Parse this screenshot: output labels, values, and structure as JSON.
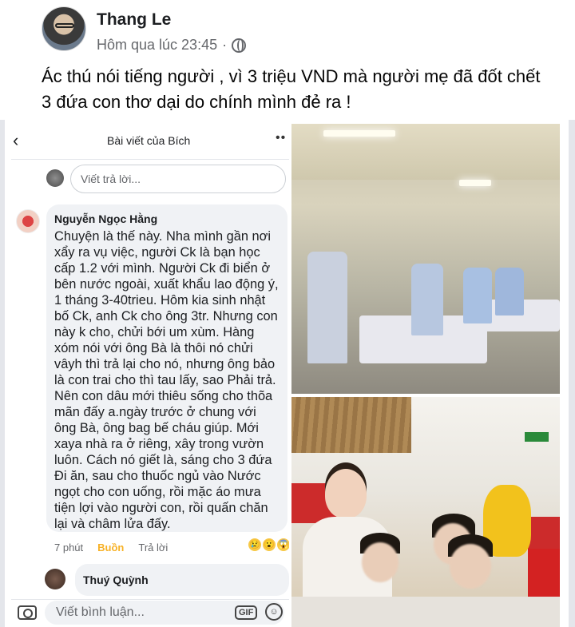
{
  "post": {
    "author": "Thang Le",
    "timestamp": "Hôm qua lúc 23:45",
    "separator": "·",
    "text": "Ác thú nói tiếng người , vì 3 triệu VND mà người mẹ đã đốt chết 3 đứa con thơ dại do chính mình đẻ ra !"
  },
  "screenshot": {
    "back_icon": "‹",
    "title": "Bài viết của Bích",
    "more_icon": "••",
    "reply_placeholder": "Viết trả lời...",
    "comment": {
      "author": "Nguyễn Ngọc Hằng",
      "text": "Chuyện là thế này. Nha mình gần nơi xẩy ra vụ việc, người Ck là bạn học cấp 1.2 với mình.  Người Ck đi biển ở bên nước ngoài, xuất khẩu lao động ý, 1 tháng 3-40trieu. Hôm kia sinh nhật bố Ck, anh Ck cho ông 3tr. Nhưng con này k cho, chửi bới um xùm. Hàng xóm nói với ông Bà là thôi nó chửi vâyh thì trả lại cho nó, nhưng ông bảo là con trai cho thì tau lấy, sao Phải trả. Nên con dâu mới thiêu sống cho thõa mãn đấy a.ngày trước ở chung với ông Bà, ông bag bế cháu giúp. Mới xaya nhà ra ở riêng, xây trong vườn luôn. Cách nó giết là,  sáng cho 3 đứa Đi ăn, sau cho thuốc ngủ vào Nước ngọt cho con uống, rồi mặc áo mưa tiện lợi  vào người con, rồi quấn chăn lại và châm lửa đấy.",
      "time": "7 phút",
      "reaction_label": "Buồn",
      "reply_label": "Trả lời",
      "reaction_emojis": [
        "😢",
        "😮",
        "😱"
      ],
      "reaction_count": ""
    },
    "reply_author": "Thuý Quỳnh",
    "comment_placeholder": "Viết bình luận...",
    "gif_label": "GIF",
    "camera_icon": "camera-icon",
    "smile_icon": "smile-icon"
  }
}
